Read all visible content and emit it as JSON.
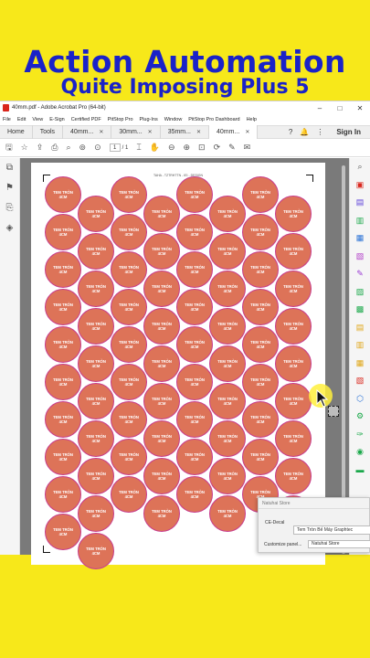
{
  "headline": {
    "line1": "Action Automation",
    "line2": "Quite Imposing Plus 5"
  },
  "window": {
    "title": "40mm.pdf - Adobe Acrobat Pro (64-bit)",
    "controls": [
      "–",
      "□",
      "✕"
    ]
  },
  "menu": [
    "File",
    "Edit",
    "View",
    "E-Sign",
    "Certified PDF",
    "PitStop Pro",
    "Plug-Ins",
    "Window",
    "PitStop Pro Dashboard",
    "Help"
  ],
  "tabs": {
    "home": "Home",
    "tools": "Tools",
    "docs": [
      "40mm...",
      "30mm...",
      "35mm...",
      "40mm..."
    ],
    "signin": "Sign In"
  },
  "toolbar": {
    "page_current": "1",
    "page_total": "/ 1"
  },
  "document": {
    "page_header": "TAHA - TZTRHTTN - IEI - DESIGN",
    "sticker_label": "TEM TRÒN\n4CM"
  },
  "popup": {
    "header": "Natuhai Store",
    "label": "CE-Decal",
    "field": "Tem Tròn Bế Máy Graphtec",
    "customize_label": "Customize panel...",
    "customize_value": "Natuhai Store"
  },
  "colors": {
    "background": "#f7e81a",
    "title_blue": "#1a22c8",
    "sticker_fill": "#dd7358",
    "sticker_border": "#c73c8d"
  }
}
